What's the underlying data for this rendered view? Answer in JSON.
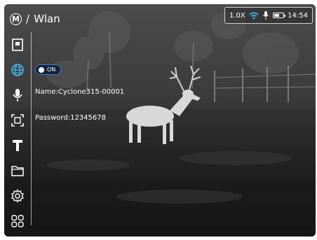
{
  "header": {
    "mode_letter": "M",
    "separator": "/",
    "title": "Wlan"
  },
  "status": {
    "zoom": "1.0X",
    "time": "14:54",
    "battery_level": 0.6,
    "wifi_icon": "wifi-icon",
    "mic_icon": "microphone-icon",
    "battery_icon": "battery-icon"
  },
  "sidebar": {
    "items": [
      {
        "name": "picture-in-picture",
        "icon": "square-frame-icon"
      },
      {
        "name": "wlan",
        "icon": "globe-icon",
        "active": true
      },
      {
        "name": "microphone",
        "icon": "microphone-icon"
      },
      {
        "name": "zoom-frame",
        "icon": "focus-frame-icon"
      },
      {
        "name": "reticle",
        "icon": "t-reticle-icon"
      },
      {
        "name": "files",
        "icon": "folder-icon"
      },
      {
        "name": "settings",
        "icon": "gear-icon"
      },
      {
        "name": "apps",
        "icon": "grid-icon"
      }
    ]
  },
  "wlan": {
    "toggle_label": "ON",
    "name_line": "Name:Cyclone315-00001",
    "password_line": "Password:12345678"
  },
  "colors": {
    "accent": "#2f7fd6",
    "wifi": "#3fb8f0",
    "text": "#ffffff"
  }
}
